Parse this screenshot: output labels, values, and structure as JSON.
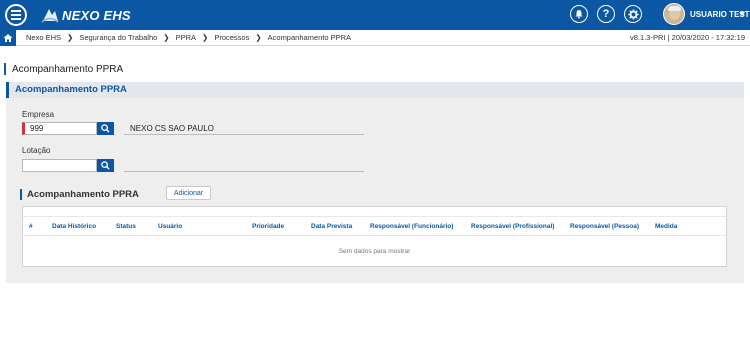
{
  "app": {
    "logo_text": "NEXO EHS"
  },
  "user": {
    "name": "USUARIO TESTE"
  },
  "breadcrumb": [
    "Nexo EHS",
    "Segurança do Trabalho",
    "PPRA",
    "Processos",
    "Acompanhamento PPRA"
  ],
  "version": "v8.1.3-PRI | 20/03/2020 - 17:32:19",
  "page": {
    "title": "Acompanhamento PPRA"
  },
  "panel": {
    "title": "Acompanhamento PPRA"
  },
  "form": {
    "empresa": {
      "label": "Empresa",
      "value": "999",
      "description": "NEXO CS SAO PAULO"
    },
    "lotacao": {
      "label": "Lotação",
      "value": "",
      "description": ""
    }
  },
  "grid": {
    "title": "Acompanhamento PPRA",
    "add_label": "Adicionar",
    "columns": [
      "#",
      "Data Histórico",
      "Status",
      "Usuário",
      "Prioridade",
      "Data Prevista",
      "Responsável (Funcionário)",
      "Responsável (Profissional)",
      "Responsável (Pessoa)",
      "Medida"
    ],
    "empty_text": "Sem dados para mostrar"
  },
  "colors": {
    "primary": "#0b57a4",
    "required": "#d13438"
  },
  "icons": [
    "menu-icon",
    "bell-icon",
    "help-icon",
    "gear-icon",
    "home-icon",
    "search-icon",
    "chevron-down-icon"
  ]
}
